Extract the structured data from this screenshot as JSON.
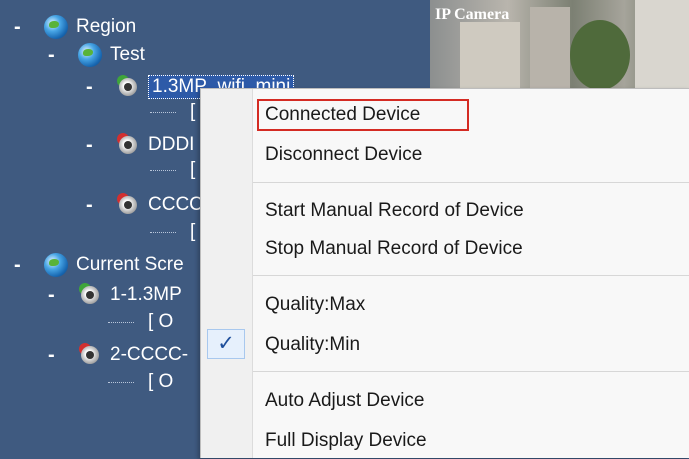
{
  "tree": {
    "region": {
      "toggle": "-",
      "label": "Region"
    },
    "test": {
      "toggle": "-",
      "label": "Test"
    },
    "device1": {
      "toggle": "-",
      "label": "1.3MP_wifi_mini"
    },
    "device1_child": "[",
    "device2": {
      "toggle": "-",
      "label": "DDDI"
    },
    "device2_child": "[",
    "device3": {
      "toggle": "-",
      "label": "CCCC"
    },
    "device3_child": "[",
    "current": {
      "toggle": "-",
      "label": "Current Scre"
    },
    "screen1": {
      "toggle": "-",
      "label": "1-1.3MP"
    },
    "screen1_child": "[ O",
    "screen2": {
      "toggle": "-",
      "label": "2-CCCC-"
    },
    "screen2_child": "[ O"
  },
  "camera": {
    "overlay_text": "IP Camera"
  },
  "menu": {
    "items": [
      {
        "label": "Connected Device"
      },
      {
        "label": "Disconnect Device"
      },
      {
        "label": "Start Manual Record of Device"
      },
      {
        "label": "Stop Manual Record of Device"
      },
      {
        "label": "Quality:Max"
      },
      {
        "label": "Quality:Min",
        "check": "✓"
      },
      {
        "label": "Auto Adjust Device"
      },
      {
        "label": "Full Display Device"
      }
    ]
  },
  "colors": {
    "tree_bg": "#3f5a80",
    "highlight_border": "#d42b23",
    "menu_bg": "#f8f8f8",
    "check_color": "#1f4f9b"
  },
  "icons": {
    "globe": "globe-icon",
    "camera_online": "camera-online-icon",
    "camera_offline": "camera-offline-icon",
    "check": "check-icon"
  }
}
